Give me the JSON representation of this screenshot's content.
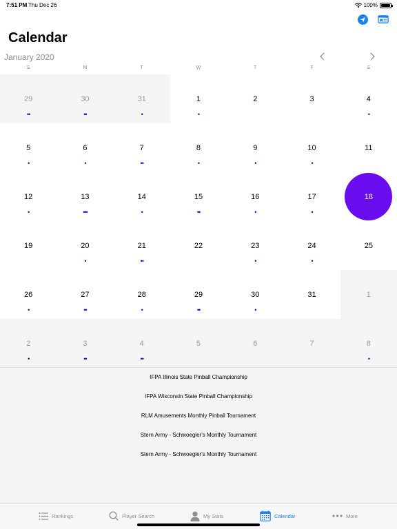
{
  "status_bar": {
    "time": "7:51 PM",
    "date": "Thu Dec 26",
    "battery": "100%"
  },
  "header": {
    "title": "Calendar",
    "actions": [
      "location-arrow-icon",
      "calendar-card-icon"
    ]
  },
  "calendar": {
    "month": "January 2020",
    "weekdays": [
      "S",
      "M",
      "T",
      "W",
      "T",
      "F",
      "S"
    ],
    "weeks": [
      [
        {
          "day": "29",
          "out": true,
          "dots": "••"
        },
        {
          "day": "30",
          "out": true,
          "dots": "••"
        },
        {
          "day": "31",
          "out": true,
          "dots": "•"
        },
        {
          "day": "1",
          "dots": "•"
        },
        {
          "day": "2",
          "dots": ""
        },
        {
          "day": "3",
          "dots": ""
        },
        {
          "day": "4",
          "dots": "•"
        }
      ],
      [
        {
          "day": "5",
          "dots": "•"
        },
        {
          "day": "6",
          "dots": "•"
        },
        {
          "day": "7",
          "dots": "••"
        },
        {
          "day": "8",
          "dots": "•"
        },
        {
          "day": "9",
          "dots": "•"
        },
        {
          "day": "10",
          "dots": "•"
        },
        {
          "day": "11",
          "dots": ""
        }
      ],
      [
        {
          "day": "12",
          "dots": "•"
        },
        {
          "day": "13",
          "dots": "•••"
        },
        {
          "day": "14",
          "dots": "•"
        },
        {
          "day": "15",
          "dots": "••"
        },
        {
          "day": "16",
          "dots": "•"
        },
        {
          "day": "17",
          "dots": "•"
        },
        {
          "day": "18",
          "dots": "",
          "selected": true
        }
      ],
      [
        {
          "day": "19",
          "dots": ""
        },
        {
          "day": "20",
          "dots": "•"
        },
        {
          "day": "21",
          "dots": "••"
        },
        {
          "day": "22",
          "dots": ""
        },
        {
          "day": "23",
          "dots": "•"
        },
        {
          "day": "24",
          "dots": "•"
        },
        {
          "day": "25",
          "dots": ""
        }
      ],
      [
        {
          "day": "26",
          "dots": "•"
        },
        {
          "day": "27",
          "dots": "••"
        },
        {
          "day": "28",
          "dots": "•"
        },
        {
          "day": "29",
          "dots": "••"
        },
        {
          "day": "30",
          "dots": "•"
        },
        {
          "day": "31",
          "dots": ""
        },
        {
          "day": "1",
          "out": true,
          "dots": ""
        }
      ],
      [
        {
          "day": "2",
          "out": true,
          "dots": "•"
        },
        {
          "day": "3",
          "out": true,
          "dots": "••"
        },
        {
          "day": "4",
          "out": true,
          "dots": "••"
        },
        {
          "day": "5",
          "out": true,
          "dots": ""
        },
        {
          "day": "6",
          "out": true,
          "dots": ""
        },
        {
          "day": "7",
          "out": true,
          "dots": ""
        },
        {
          "day": "8",
          "out": true,
          "dots": "•"
        }
      ]
    ],
    "selected_color": "#6a0dee",
    "dot_color": "#0a0acc"
  },
  "events": [
    "IFPA Illinois State Pinball Championship",
    "IFPA Wisconsin State Pinball Championship",
    "RLM Amusements Monthly Pinball Tournament",
    "Stern Army - Schwoegler's Monthly Tournament",
    "Stern Army - Schwoegler's Monthly Tournament"
  ],
  "tabs": [
    {
      "label": "Rankings",
      "icon": "list-icon"
    },
    {
      "label": "Player Search",
      "icon": "search-icon"
    },
    {
      "label": "My Stats",
      "icon": "person-icon"
    },
    {
      "label": "Calendar",
      "icon": "calendar-icon",
      "active": true
    },
    {
      "label": "More",
      "icon": "more-dots-icon"
    }
  ],
  "accent_color": "#1a82f7"
}
